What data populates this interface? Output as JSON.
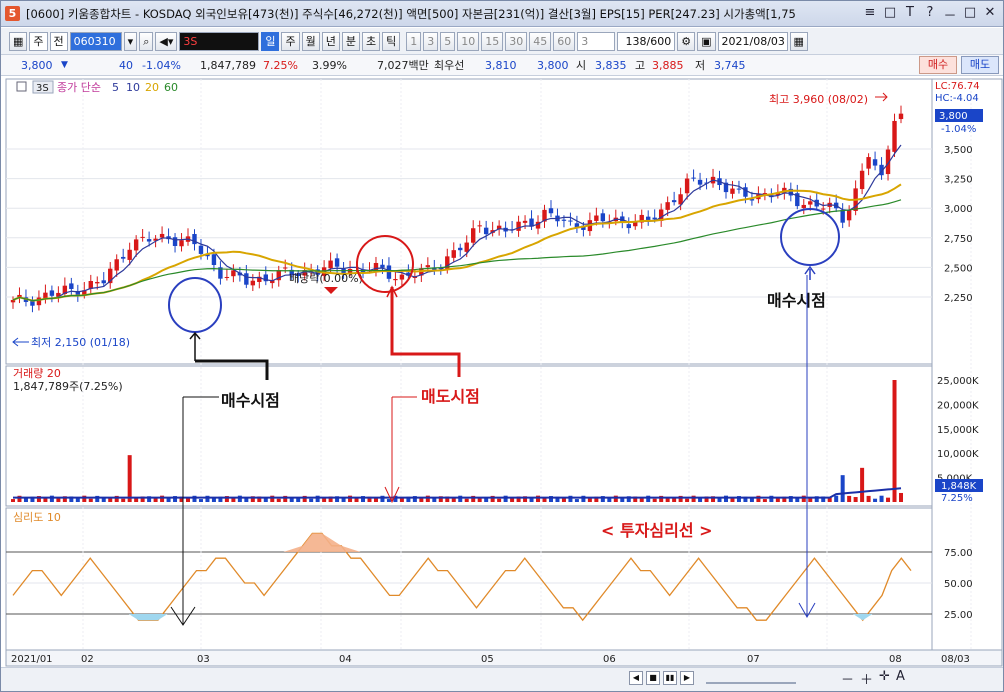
{
  "window": {
    "title": "[0600] 키움종합차트 - KOSDAQ 외국인보유[473(천)] 주식수[46,272(천)] 액면[500] 자본금[231(억)] 결산[3월] EPS[15] PER[247.23] 시가총액[1,75",
    "app_badge": "5",
    "buttons": [
      "≡",
      "□",
      "T",
      "?",
      "－",
      "□",
      "✕"
    ]
  },
  "toolbar": {
    "stock_type": "주",
    "prev": "전",
    "code": "060310",
    "period_label": "3S",
    "intervals": [
      "일",
      "주",
      "월",
      "년",
      "분",
      "초",
      "틱"
    ],
    "selected_interval": "일",
    "minutes": [
      "1",
      "3",
      "5",
      "10",
      "15",
      "30",
      "45",
      "60"
    ],
    "count_select": "3",
    "range": "138/600",
    "date": "2021/08/03"
  },
  "quote": {
    "price": "3,800",
    "change": "40",
    "change_rate": "-1.04%",
    "volume": "1,847,789",
    "volume_rate": "7.25%",
    "turnover": "3.99%",
    "amount": "7,027백만",
    "best_label": "최우선",
    "ask": "3,810",
    "bid": "3,800",
    "open_label": "시",
    "open": "3,835",
    "high_label": "고",
    "high": "3,885",
    "low_label": "저",
    "low": "3,745",
    "buy": "매수",
    "sell": "매도"
  },
  "chart": {
    "price_panel": {
      "tag": "3S",
      "ma_label": "종가 단순",
      "ma_periods": [
        {
          "v": "5",
          "color": "#2e3a9b"
        },
        {
          "v": "10",
          "color": "#2e3a9b"
        },
        {
          "v": "20",
          "color": "#d8a500"
        },
        {
          "v": "60",
          "color": "#2a8a2a"
        }
      ],
      "lc": "LC:76.74",
      "hc": "HC:-4.04",
      "current_price": "3,800",
      "current_rate": "-1.04%",
      "high_note": "최고 3,960 (08/02)",
      "low_note": "최저 2,150 (01/18)",
      "dividend_note": "배당락(0.00%)",
      "y_ticks": [
        "3,500",
        "3,250",
        "3,000",
        "2,750",
        "2,500",
        "2,250"
      ]
    },
    "volume_panel": {
      "label": "거래량 20",
      "value": "1,847,789주(7.25%)",
      "y_ticks": [
        "25,000K",
        "20,000K",
        "15,000K",
        "10,000K",
        "5,000K"
      ],
      "current": "1,848K",
      "current_rate": "7.25%"
    },
    "psych_panel": {
      "label": "심리도 10",
      "y_ticks": [
        "75.00",
        "50.00",
        "25.00"
      ]
    },
    "x_ticks": [
      "2021/01",
      "02",
      "03",
      "04",
      "05",
      "06",
      "07",
      "08",
      "08/03"
    ]
  },
  "annotations": {
    "buy_signal_1": "매수시점",
    "sell_signal": "매도시점",
    "buy_signal_2": "매수시점",
    "psych_line": "< 투자심리선 >"
  },
  "colors": {
    "up": "#d81818",
    "down": "#1a45c8",
    "ma20": "#d8a500",
    "ma60": "#2a8a2a",
    "psych": "#e08a2a"
  }
}
